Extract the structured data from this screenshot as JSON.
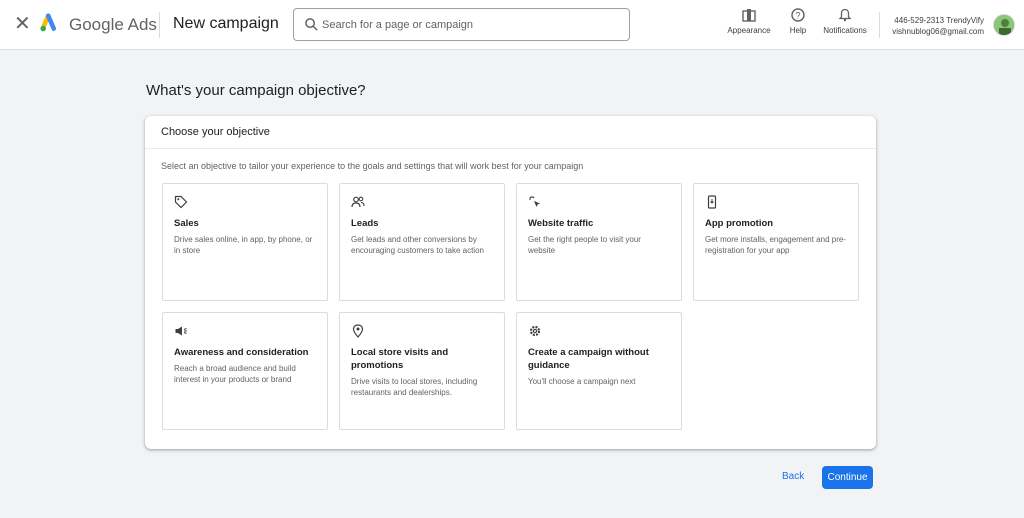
{
  "header": {
    "close_icon": "close-icon",
    "brand": "Google Ads",
    "page_title": "New campaign",
    "search": {
      "placeholder": "Search for a page or campaign",
      "value": ""
    },
    "tools": [
      {
        "label": "Appearance",
        "icon": "appearance-icon"
      },
      {
        "label": "Help",
        "icon": "help-icon"
      },
      {
        "label": "Notifications",
        "icon": "bell-icon"
      }
    ],
    "account": {
      "id_line": "446-529-2313 TrendyVify",
      "email": "vishnublog06@gmail.com"
    }
  },
  "main": {
    "heading": "What's your campaign objective?",
    "panel_title": "Choose your objective",
    "panel_description": "Select an objective to tailor your experience to the goals and settings that will work best for your campaign",
    "objectives": [
      {
        "title": "Sales",
        "description": "Drive sales online, in app, by phone, or in store",
        "icon": "tag-icon"
      },
      {
        "title": "Leads",
        "description": "Get leads and other conversions by encouraging customers to take action",
        "icon": "people-icon"
      },
      {
        "title": "Website traffic",
        "description": "Get the right people to visit your website",
        "icon": "cursor-click-icon"
      },
      {
        "title": "App promotion",
        "description": "Get more installs, engagement and pre-registration for your app",
        "icon": "phone-icon"
      },
      {
        "title": "Awareness and consideration",
        "description": "Reach a broad audience and build interest in your products or brand",
        "icon": "megaphone-icon"
      },
      {
        "title": "Local store visits and promotions",
        "description": "Drive visits to local stores, including restaurants and dealerships.",
        "icon": "location-pin-icon"
      },
      {
        "title": "Create a campaign without guidance",
        "description": "You'll choose a campaign next",
        "icon": "gear-icon"
      }
    ]
  },
  "footer": {
    "back_label": "Back",
    "continue_label": "Continue"
  },
  "colors": {
    "primary": "#1a73e8",
    "background": "#f1f3f4"
  }
}
